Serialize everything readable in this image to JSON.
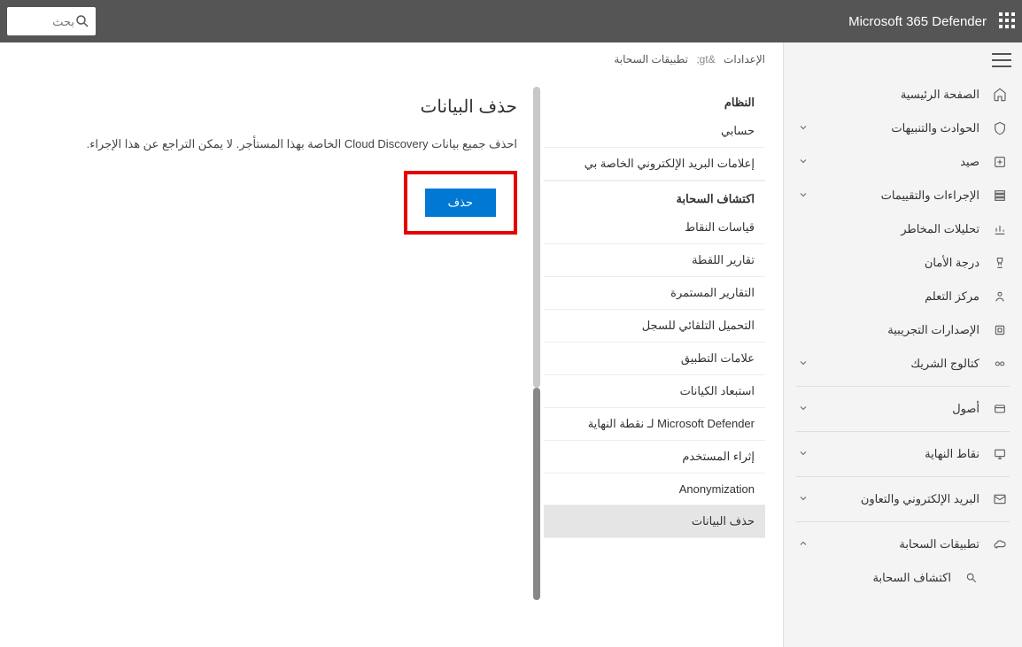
{
  "header": {
    "app_title": "Microsoft 365 Defender",
    "search_placeholder": "بحث"
  },
  "breadcrumb": {
    "part1": "الإعدادات",
    "sep": "&gt;",
    "part2": "تطبيقات السحابة"
  },
  "sidebar": {
    "items": [
      {
        "label": "الصفحة الرئيسية",
        "icon": "home",
        "expand": ""
      },
      {
        "label": "الحوادث والتنبيهات",
        "icon": "shield",
        "expand": "down"
      },
      {
        "label": "صيد",
        "icon": "hunt",
        "expand": "down"
      },
      {
        "label": "الإجراءات والتقييمات",
        "icon": "actions",
        "expand": "down"
      },
      {
        "label": "تحليلات المخاطر",
        "icon": "analytics",
        "expand": ""
      },
      {
        "label": "درجة الأمان",
        "icon": "trophy",
        "expand": ""
      },
      {
        "label": "مركز التعلم",
        "icon": "learn",
        "expand": ""
      },
      {
        "label": "الإصدارات التجريبية",
        "icon": "trial",
        "expand": ""
      },
      {
        "label": "كتالوج الشريك",
        "icon": "partner",
        "expand": "down",
        "sep_after": true
      },
      {
        "label": "أصول",
        "icon": "assets",
        "expand": "down",
        "sep_after": true
      },
      {
        "label": "نقاط النهاية",
        "icon": "endpoints",
        "expand": "down",
        "sep_after": true
      },
      {
        "label": "البريد الإلكتروني والتعاون",
        "icon": "mail",
        "expand": "down",
        "sep_after": true
      },
      {
        "label": "تطبيقات السحابة",
        "icon": "cloud",
        "expand": "up",
        "sub": [
          {
            "label": "اكتشاف السحابة",
            "icon": "discovery"
          }
        ]
      }
    ]
  },
  "settings": {
    "group1_head": "النظام",
    "items1": [
      "حسابي",
      "إعلامات البريد الإلكتروني الخاصة بي"
    ],
    "group2_head": "اكتشاف السحابة",
    "items2": [
      "قياسات النقاط",
      "تقارير اللقطة",
      "التقارير المستمرة",
      "التحميل التلقائي للسجل",
      "علامات التطبيق",
      "استبعاد الكيانات",
      "Microsoft Defender لـ نقطة النهاية",
      "إثراء المستخدم",
      "Anonymization",
      "حذف البيانات"
    ]
  },
  "main": {
    "title": "حذف البيانات",
    "description": "احذف جميع بيانات Cloud Discovery الخاصة بهذا المستأجر. لا يمكن التراجع عن هذا الإجراء.",
    "delete_label": "حذف"
  }
}
